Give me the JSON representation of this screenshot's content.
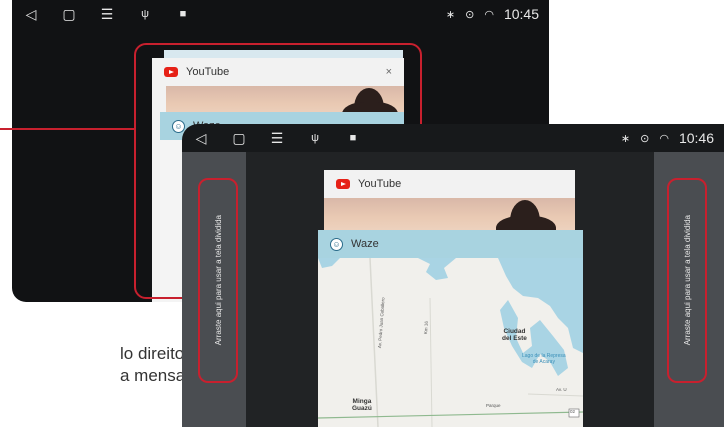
{
  "back_screen": {
    "status": {
      "time": "10:45"
    },
    "cards": [
      {
        "app": "YouTube",
        "close": "×"
      },
      {
        "app": "Waze"
      }
    ]
  },
  "front_screen": {
    "status": {
      "time": "10:46"
    },
    "cards": [
      {
        "app": "YouTube"
      },
      {
        "app": "Waze"
      }
    ],
    "left_drop_zone": "Arraste aqui para usar a tela dividida",
    "right_drop_zone": "Arraste aqui para usar a tela dividida",
    "map": {
      "labels": {
        "city": "Ciudad\ndel Este",
        "lake": "Lago de la Represa\nde Acaray",
        "minga": "Minga\nGuazú",
        "road_1": "Av. Pedro Juan Caballero",
        "road_2": "Km 16",
        "road_3": "Av. U",
        "route": "02",
        "poi": "Parque"
      }
    }
  },
  "caption": {
    "line1": "lo direito ou",
    "line2": "a mensagem"
  },
  "colors": {
    "highlight": "#c8202e",
    "youtube": "#e62117",
    "waze_header": "#a8d3e0"
  }
}
